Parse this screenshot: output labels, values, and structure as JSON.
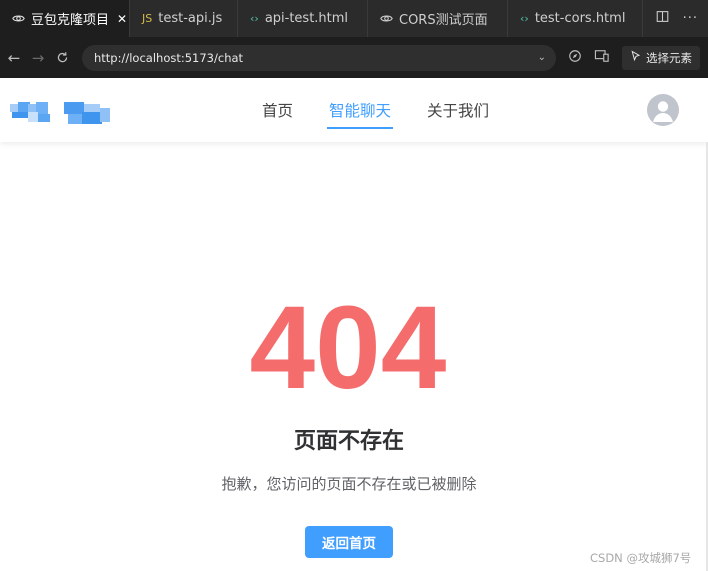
{
  "browser": {
    "tabs": [
      {
        "label": "豆包克隆项目",
        "icon": "eye-icon",
        "active": true,
        "closable": true
      },
      {
        "label": "test-api.js",
        "icon": "js-icon",
        "icon_text": "JS"
      },
      {
        "label": "api-test.html",
        "icon": "code-icon"
      },
      {
        "label": "CORS测试页面",
        "icon": "eye-icon"
      },
      {
        "label": "test-cors.html",
        "icon": "code-icon"
      }
    ],
    "url": "http://localhost:5173/chat",
    "pick_element_label": "选择元素"
  },
  "header": {
    "nav": [
      {
        "label": "首页",
        "active": false
      },
      {
        "label": "智能聊天",
        "active": true
      },
      {
        "label": "关于我们",
        "active": false
      }
    ],
    "avatar_icon": "user-avatar-icon"
  },
  "main": {
    "error_code": "404",
    "title": "页面不存在",
    "description": "抱歉，您访问的页面不存在或已被删除",
    "home_button": "返回首页"
  },
  "watermark": "CSDN @攻城狮7号",
  "colors": {
    "accent": "#409eff",
    "error": "#f56c6c",
    "title": "#303133",
    "text": "#606266"
  }
}
